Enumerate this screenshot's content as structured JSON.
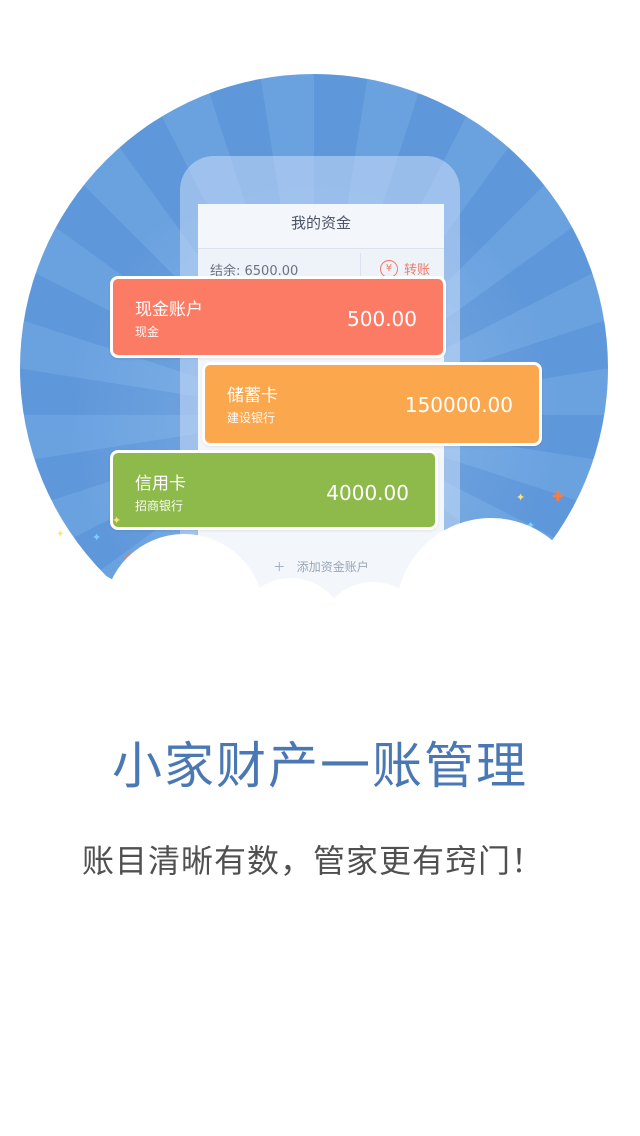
{
  "app_screen": {
    "title": "我的资金",
    "balance": "结余: 6500.00",
    "transfer_label": "转账",
    "add_account": "添加资金账户"
  },
  "accounts": [
    {
      "name": "现金账户",
      "sub": "现金",
      "amount": "500.00",
      "color": "#fb7b64"
    },
    {
      "name": "储蓄卡",
      "sub": "建设银行",
      "amount": "150000.00",
      "color": "#faa74e"
    },
    {
      "name": "信用卡",
      "sub": "招商银行",
      "amount": "4000.00",
      "color": "#8dba4a"
    }
  ],
  "headline": "小家财产一账管理",
  "subline": "账目清晰有数，管家更有窍门！",
  "colors": {
    "circle_blue": "#5e97da",
    "headline": "#4a78b5",
    "subline": "#505050"
  },
  "icons": [
    "yen-circle-icon",
    "plus-icon",
    "sparkle-icon"
  ]
}
